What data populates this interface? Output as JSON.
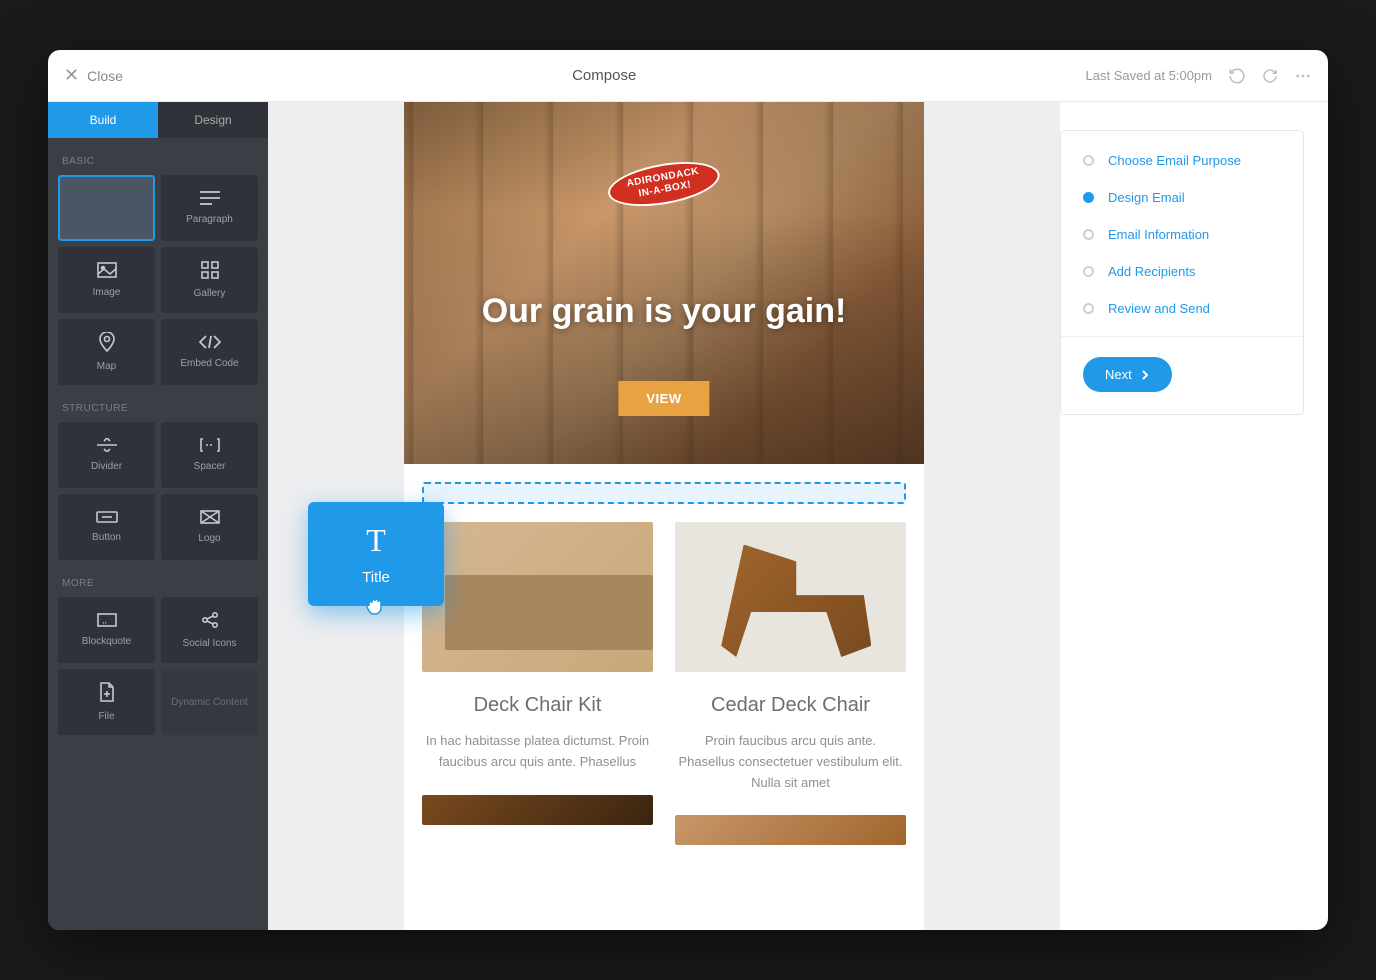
{
  "topbar": {
    "close": "Close",
    "title": "Compose",
    "last_saved": "Last Saved at 5:00pm"
  },
  "sidebar": {
    "tabs": {
      "build": "Build",
      "design": "Design"
    },
    "sections": {
      "basic": {
        "label": "BASIC",
        "items": [
          {
            "id": "blank",
            "label": "",
            "icon": "blank"
          },
          {
            "id": "paragraph",
            "label": "Paragraph",
            "icon": "paragraph"
          },
          {
            "id": "image",
            "label": "Image",
            "icon": "image"
          },
          {
            "id": "gallery",
            "label": "Gallery",
            "icon": "gallery"
          },
          {
            "id": "map",
            "label": "Map",
            "icon": "map"
          },
          {
            "id": "embed",
            "label": "Embed Code",
            "icon": "code"
          }
        ]
      },
      "structure": {
        "label": "STRUCTURE",
        "items": [
          {
            "id": "divider",
            "label": "Divider",
            "icon": "divider"
          },
          {
            "id": "spacer",
            "label": "Spacer",
            "icon": "spacer"
          },
          {
            "id": "button",
            "label": "Button",
            "icon": "button"
          },
          {
            "id": "logo",
            "label": "Logo",
            "icon": "logo"
          }
        ]
      },
      "more": {
        "label": "MORE",
        "items": [
          {
            "id": "blockquote",
            "label": "Blockquote",
            "icon": "quote"
          },
          {
            "id": "social",
            "label": "Social Icons",
            "icon": "share"
          },
          {
            "id": "file",
            "label": "File",
            "icon": "file"
          },
          {
            "id": "dynamic",
            "label": "Dynamic Content",
            "icon": "dynamic",
            "disabled": true
          }
        ]
      }
    }
  },
  "dragging": {
    "label": "Title"
  },
  "preview": {
    "badge_line1": "ADIRONDACK",
    "badge_line2": "IN-A-BOX!",
    "headline": "Our grain is your gain!",
    "cta": "VIEW",
    "products": [
      {
        "title": "Deck Chair Kit",
        "desc": "In hac habitasse platea dictumst. Proin faucibus arcu quis ante. Phasellus"
      },
      {
        "title": "Cedar Deck Chair",
        "desc": "Proin faucibus arcu quis ante. Phasellus consectetuer vestibulum elit. Nulla sit amet"
      }
    ]
  },
  "steps": {
    "items": [
      "Choose Email Purpose",
      "Design Email",
      "Email Information",
      "Add Recipients",
      "Review and Send"
    ],
    "active_index": 1,
    "next": "Next"
  }
}
